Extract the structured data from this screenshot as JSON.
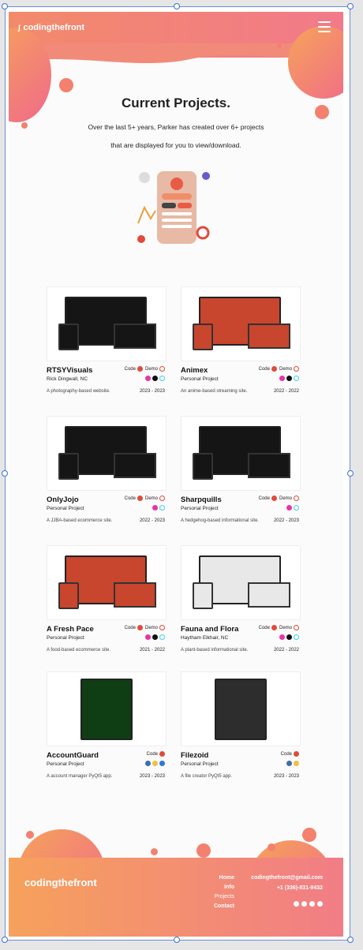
{
  "header": {
    "logo": "codingthefront"
  },
  "hero": {
    "title": "Current Projects.",
    "line1": "Over the last 5+ years, Parker has created over 6+ projects",
    "line2": "that are displayed for you to view/download."
  },
  "labels": {
    "code": "Code",
    "demo": "Demo"
  },
  "projects": [
    {
      "title": "RTSYVisuals",
      "location": "Rick Dingwall, NC",
      "desc": "A photography-based website.",
      "years": "2023 - 2023",
      "theme": "dark"
    },
    {
      "title": "Animex",
      "location": "Personal Project",
      "desc": "An anime-based streaming site.",
      "years": "2022 - 2022",
      "theme": "red"
    },
    {
      "title": "OnlyJojo",
      "location": "Personal Project",
      "desc": "A JJBA-based ecommerce site.",
      "years": "2022 - 2023",
      "theme": "dark"
    },
    {
      "title": "Sharpquills",
      "location": "Personal Project",
      "desc": "A hedgehog-based informational site.",
      "years": "2022 - 2023",
      "theme": "dark"
    },
    {
      "title": "A Fresh Pace",
      "location": "Personal Project",
      "desc": "A food-based ecommerce site.",
      "years": "2021 - 2022",
      "theme": "red"
    },
    {
      "title": "Fauna and Flora",
      "location": "Haytham Elkhair, NC",
      "desc": "A plant-based informational site.",
      "years": "2022 - 2022",
      "theme": "light"
    },
    {
      "title": "AccountGuard",
      "location": "Personal Project",
      "desc": "A account manager PyQt5 app.",
      "years": "2023 - 2023",
      "theme": "green"
    },
    {
      "title": "Filezoid",
      "location": "Personal Project",
      "desc": "A file creator PyQt5 app.",
      "years": "2023 - 2023",
      "theme": "gray"
    }
  ],
  "footer": {
    "logo": "codingthefront",
    "nav": [
      "Home",
      "Info",
      "Projects",
      "Contact"
    ],
    "email": "codingthefront@gmail.com",
    "phone": "+1 (336)-831-9432"
  },
  "colors": {
    "accent": "#f28a6a",
    "accent2": "#f27a8a",
    "red": "#e04b3a"
  }
}
